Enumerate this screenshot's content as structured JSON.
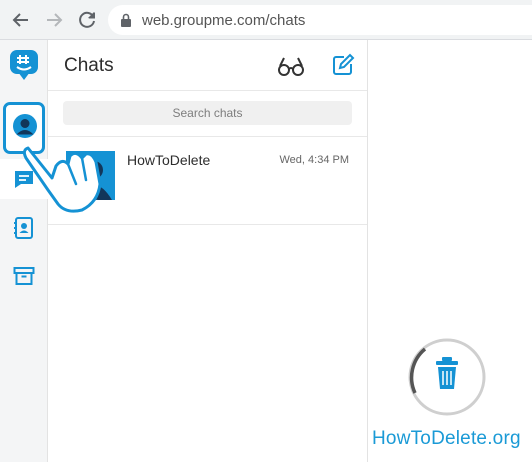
{
  "browser": {
    "url": "web.groupme.com/chats",
    "buttons": [
      "back-icon",
      "forward-icon",
      "reload-icon"
    ]
  },
  "rail": {
    "items": [
      {
        "name": "groupme-logo-icon"
      },
      {
        "name": "profile-icon"
      },
      {
        "name": "chats-icon",
        "selected": true
      },
      {
        "name": "contacts-icon"
      },
      {
        "name": "archive-icon"
      }
    ],
    "accent": "#1592d4"
  },
  "chats": {
    "title": "Chats",
    "search_placeholder": "Search chats",
    "items": [
      {
        "name": "HowToDelete",
        "time": "Wed, 4:34 PM"
      }
    ]
  },
  "watermark": {
    "text": "HowToDelete.org",
    "color": "#1a9ad6"
  }
}
